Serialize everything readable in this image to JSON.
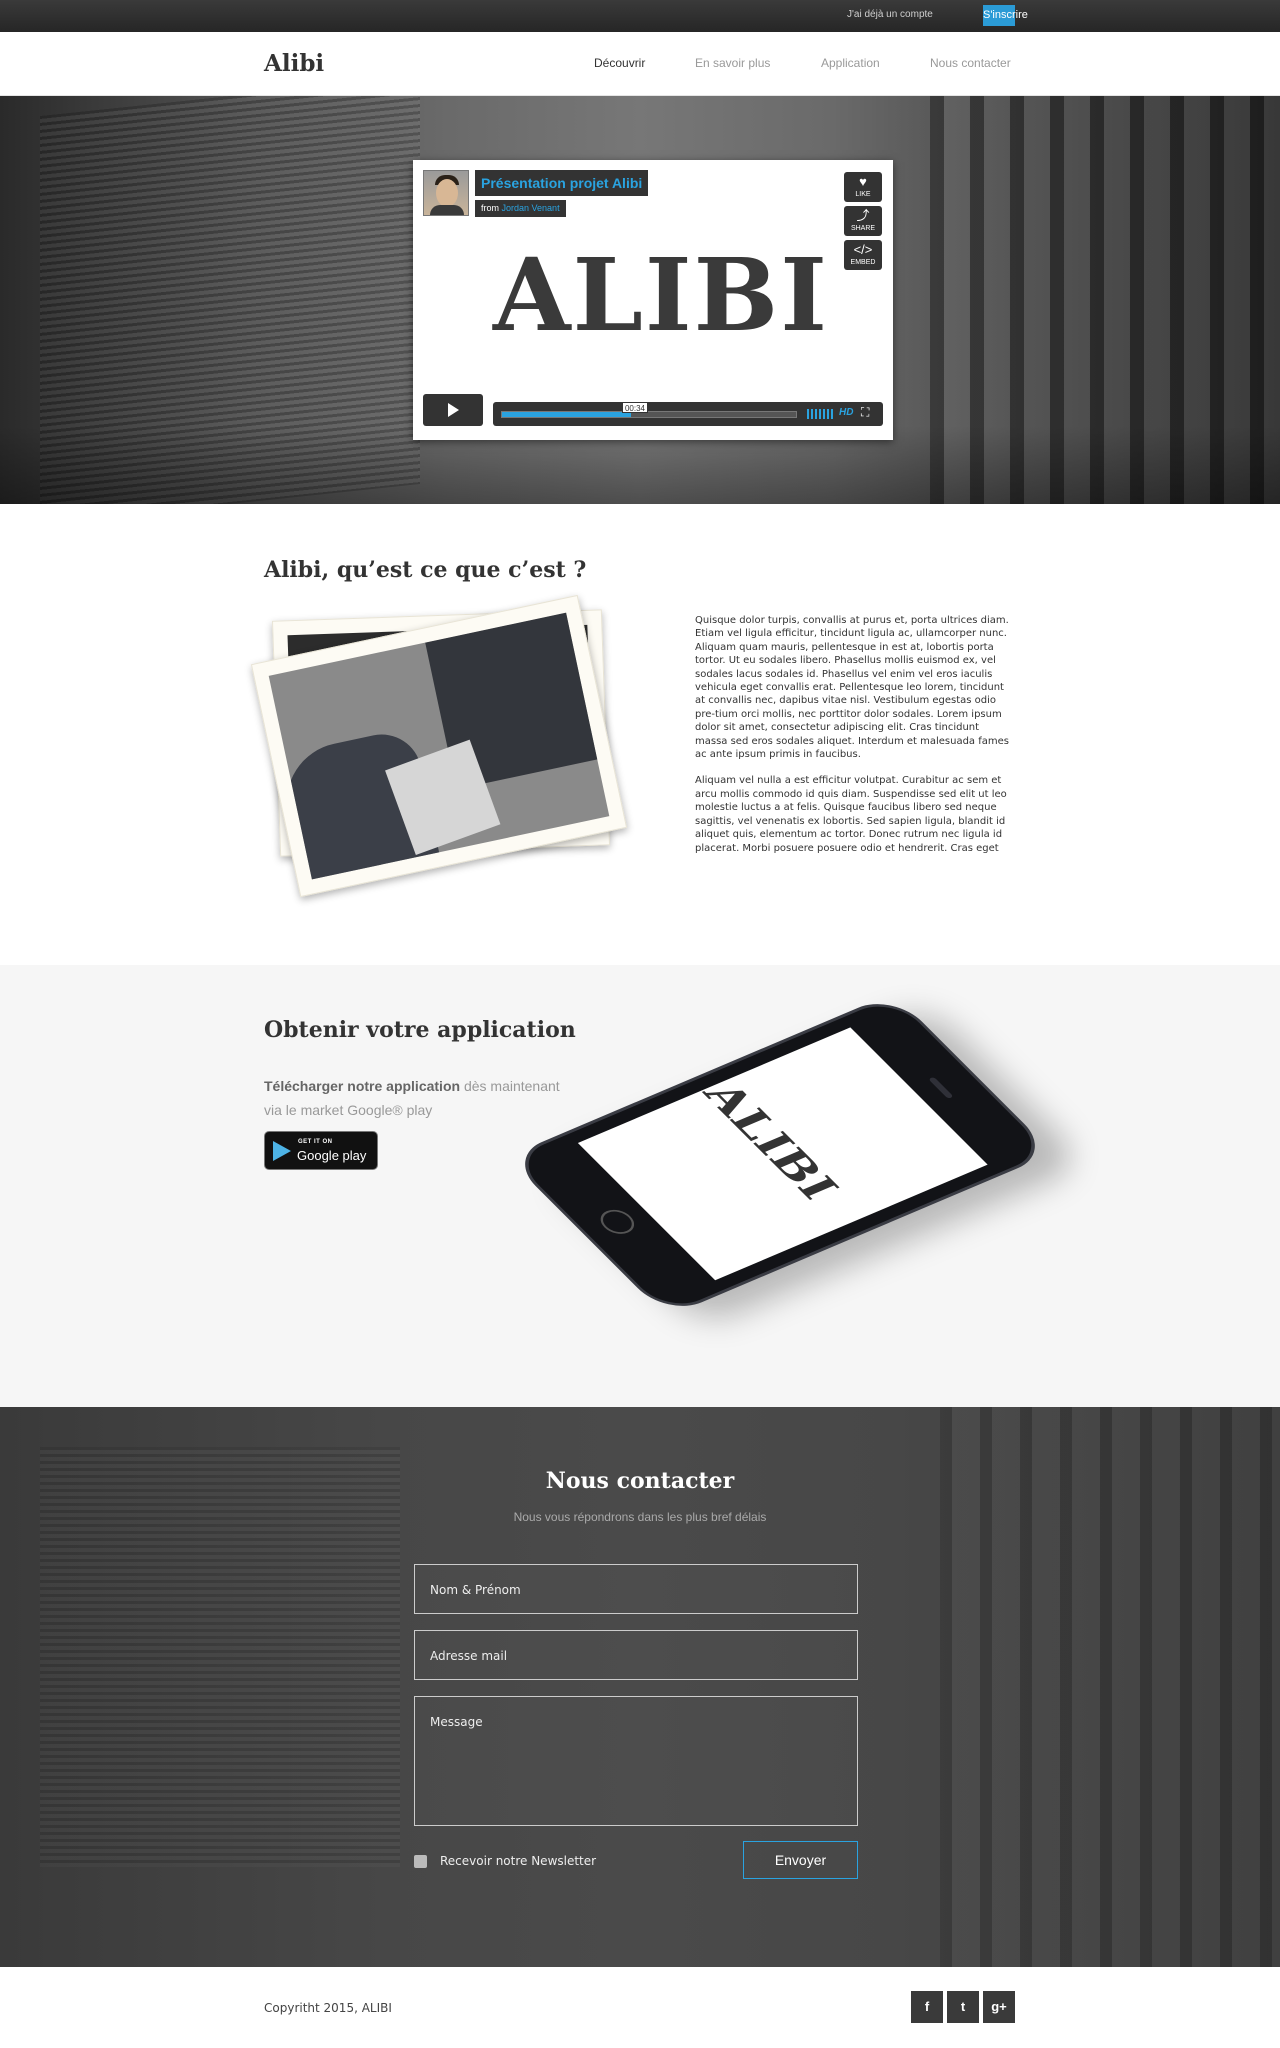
{
  "topbar": {
    "already_account": "J'ai déjà un compte",
    "signup": "S'inscrire"
  },
  "header": {
    "brand": "Alibi",
    "nav": [
      "Découvrir",
      "En savoir plus",
      "Application",
      "Nous contacter"
    ]
  },
  "video": {
    "title": "Présentation projet Alibi",
    "from_label": "from",
    "author": "Jordan Venant",
    "like": "LIKE",
    "share": "SHARE",
    "embed": "EMBED",
    "logo": "ALIBI",
    "time": "00:34",
    "hd": "HD",
    "progress": 0.44
  },
  "about": {
    "title": "Alibi, qu’est ce que c’est ?",
    "paragraphs": [
      "Quisque dolor turpis, convallis at purus et, porta ultrices diam. Etiam vel ligula efficitur, tincidunt ligula ac, ullamcorper nunc. Aliquam quam mauris, pellentesque in est at, lobortis porta tortor. Ut eu sodales libero. Phasellus mollis euismod ex, vel sodales lacus sodales id. Phasellus vel enim vel eros iaculis vehicula eget convallis erat. Pellentesque leo lorem, tincidunt at convallis nec, dapibus vitae nisl. Vestibulum egestas odio pre-tium orci mollis, nec porttitor dolor sodales. Lorem ipsum dolor sit amet, consectetur adipiscing elit. Cras tincidunt massa sed eros sodales aliquet. Interdum et malesuada fames ac ante ipsum primis in faucibus.",
      "Aliquam vel nulla a est efficitur volutpat. Curabitur ac sem et arcu mollis commodo id quis diam. Suspendisse sed elit ut leo molestie luctus a at felis. Quisque faucibus libero sed neque sagittis, vel venenatis ex lobortis. Sed sapien ligula, blandit id aliquet quis, elementum ac tortor. Donec rutrum nec ligula id placerat. Morbi posuere posuere odio et hendrerit. Cras eget"
    ]
  },
  "app": {
    "title": "Obtenir votre application",
    "desc_bold": "Télécharger notre application",
    "desc_rest": " dès maintenant",
    "desc_line2": "via le market Google® play",
    "badge_small": "GET IT ON",
    "badge_big": "Google play",
    "phone_logo": "ALIBI"
  },
  "contact": {
    "title": "Nous contacter",
    "subtitle": "Nous vous répondrons dans les plus bref délais",
    "name_placeholder": "Nom & Prénom",
    "email_placeholder": "Adresse mail",
    "message_placeholder": "Message",
    "newsletter": "Recevoir notre Newsletter",
    "send": "Envoyer"
  },
  "footer": {
    "copyright": "Copyritht 2015, ALIBI",
    "social": [
      {
        "icon": "facebook-icon",
        "glyph": "f"
      },
      {
        "icon": "twitter-icon",
        "glyph": "t"
      },
      {
        "icon": "googleplus-icon",
        "glyph": "g+"
      }
    ]
  },
  "colors": {
    "accent": "#2aa3e0",
    "dark": "#333333",
    "app_bg": "#f6f6f6"
  }
}
